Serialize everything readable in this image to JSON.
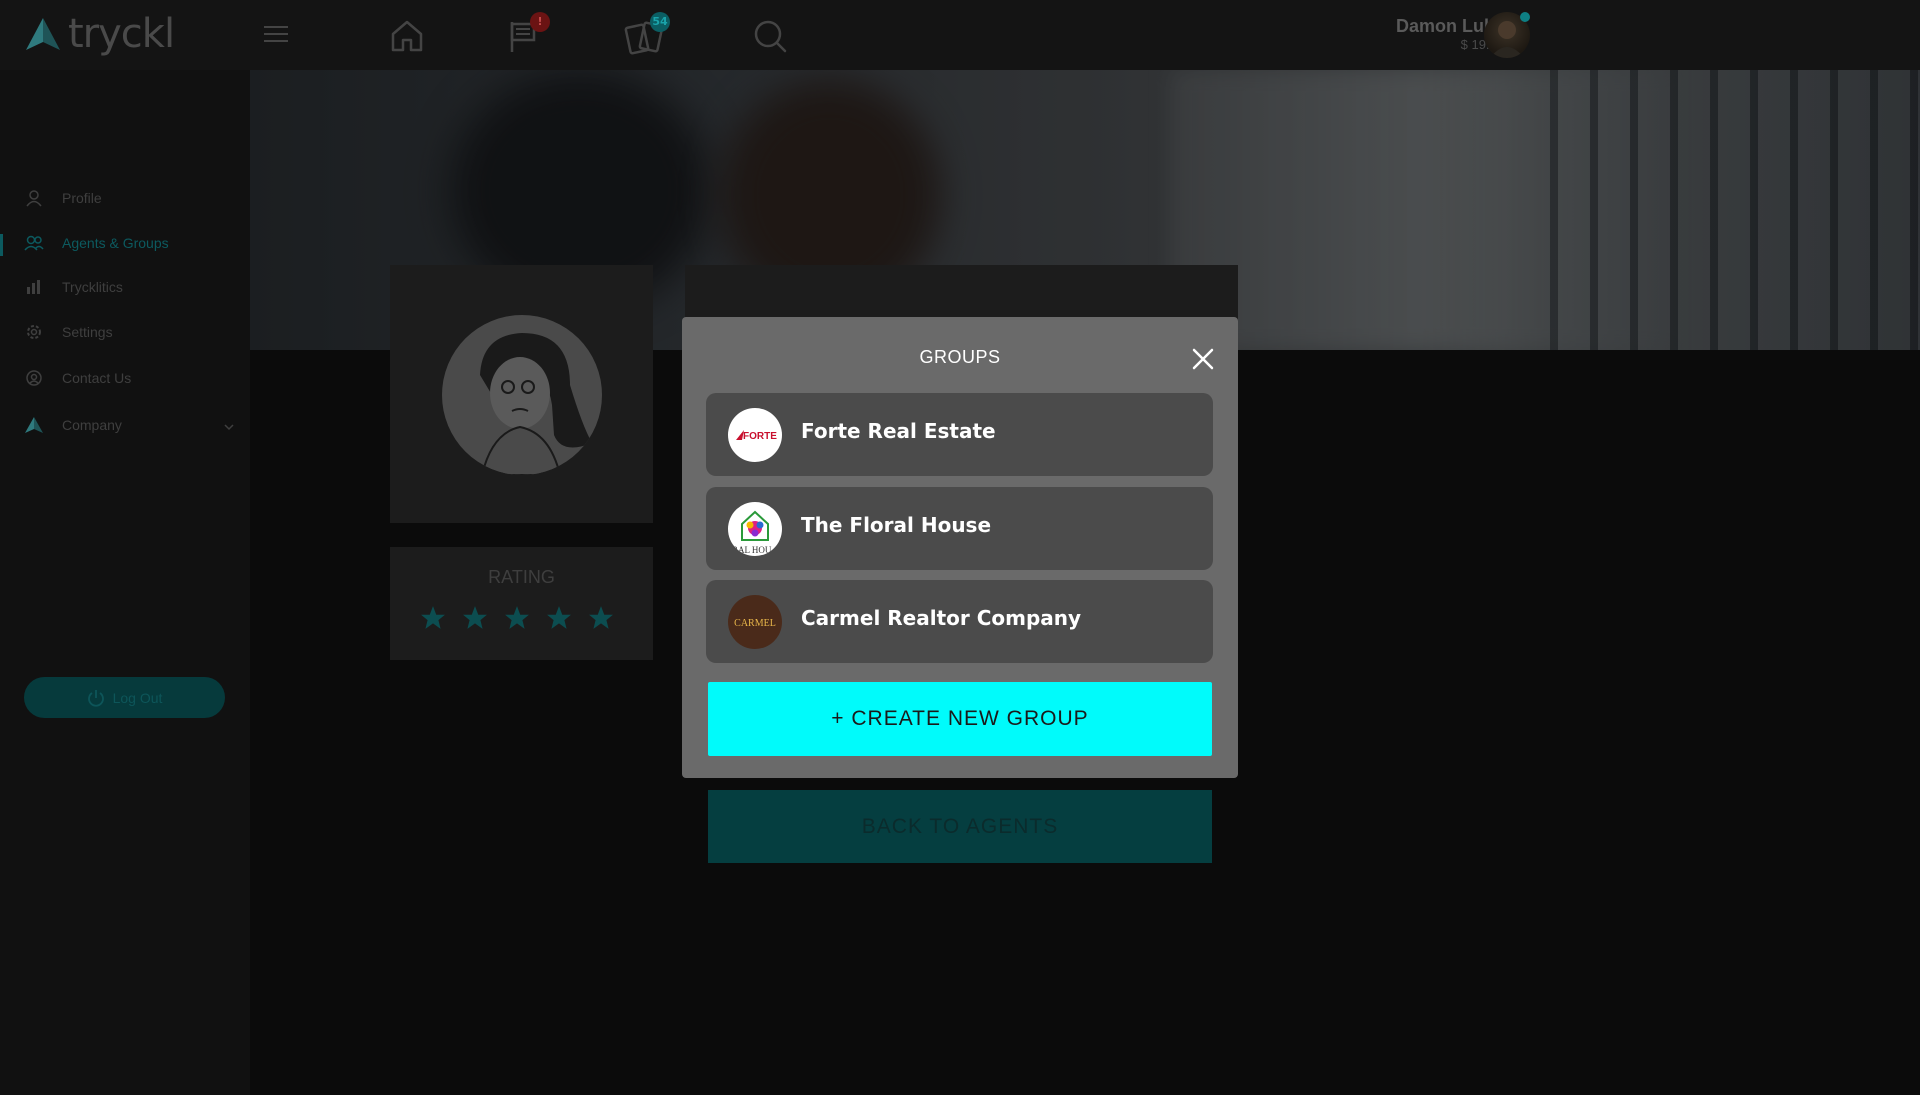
{
  "app": {
    "brand": "tryckl",
    "accent_color": "#00fbfb",
    "modal_background": "#6a6a6a"
  },
  "topbar": {
    "menu_icon": "hamburger-icon",
    "nav": [
      {
        "icon": "home-icon",
        "badge": ""
      },
      {
        "icon": "flag-icon",
        "badge": "!"
      },
      {
        "icon": "cards-icon",
        "badge": "54"
      },
      {
        "icon": "search-icon",
        "badge": ""
      }
    ],
    "user": {
      "name": "Damon Luke",
      "balance": "$ 19.75"
    }
  },
  "sidebar": {
    "items": [
      {
        "label": "Profile",
        "icon": "user-icon",
        "active": false
      },
      {
        "label": "Agents & Groups",
        "icon": "agents-icon",
        "active": true
      },
      {
        "label": "Trycklitics",
        "icon": "chart-icon",
        "active": false
      },
      {
        "label": "Settings",
        "icon": "gear-icon",
        "active": false
      },
      {
        "label": "Contact Us",
        "icon": "contact-icon",
        "active": false
      },
      {
        "label": "Company",
        "icon": "company-logo-icon",
        "active": false
      }
    ],
    "logout_label": "Log Out"
  },
  "profile": {
    "rating_label": "RATING",
    "stars": 5
  },
  "back_button_label": "BACK TO AGENTS",
  "modal": {
    "title": "GROUPS",
    "groups": [
      {
        "name": "Forte Real Estate",
        "logo_text": "FORTE",
        "logo_bg": "#ffffff",
        "logo_fg": "#c8102e"
      },
      {
        "name": "The Floral House",
        "logo_text": "RAL HOU",
        "logo_bg": "#ffffff",
        "logo_fg": "#333333"
      },
      {
        "name": "Carmel Realtor Company",
        "logo_text": "CARMEL",
        "logo_bg": "#4a2a1a",
        "logo_fg": "#e8b64a"
      }
    ],
    "create_label": "+ CREATE NEW GROUP"
  }
}
